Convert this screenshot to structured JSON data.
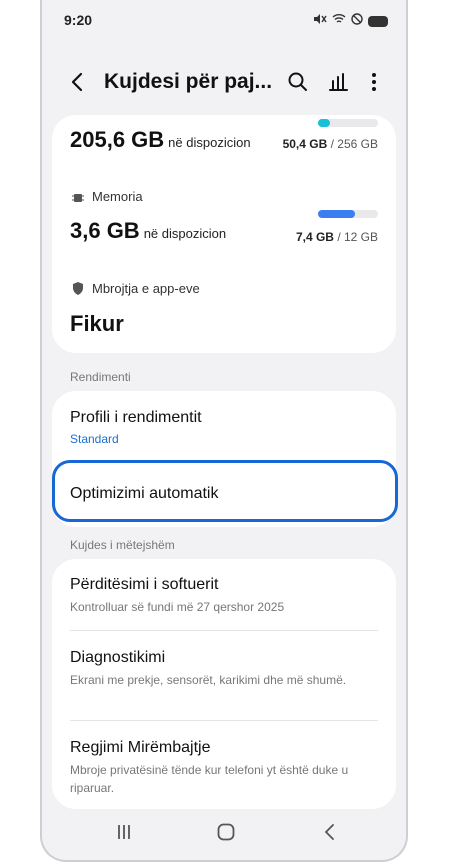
{
  "status": {
    "time": "9:20"
  },
  "appbar": {
    "title": "Kujdesi për paj..."
  },
  "storage": {
    "available_value": "205,6 GB",
    "available_suffix": "në dispozicion",
    "used": "50,4 GB",
    "total": "/ 256 GB",
    "fill_fraction": 0.2
  },
  "memory": {
    "label": "Memoria",
    "available_value": "3,6 GB",
    "available_suffix": "në dispozicion",
    "used": "7,4 GB",
    "total": "/ 12 GB",
    "fill_fraction": 0.62
  },
  "app_protection": {
    "label": "Mbrojtja e app-eve",
    "value": "Fikur"
  },
  "sections": {
    "performance": "Rendimenti",
    "further_care": "Kujdes i mëtejshëm"
  },
  "performance_items": [
    {
      "title": "Profili i rendimentit",
      "sub": "Standard"
    },
    {
      "title": "Optimizimi automatik"
    }
  ],
  "care_items": [
    {
      "title": "Përditësimi i softuerit",
      "sub": "Kontrolluar së fundi më 27 qershor 2025"
    },
    {
      "title": "Diagnostikimi",
      "sub": "Ekrani me prekje, sensorët, karikimi dhe më shumë."
    },
    {
      "title": "Regjimi Mirëmbajtje",
      "sub": "Mbroje privatësinë tënde kur telefoni yt është duke u riparuar."
    }
  ],
  "colors": {
    "accent": "#1767d6",
    "storage_bar": "#16c1d8",
    "memory_bar": "#3b7ef0",
    "link": "#1a6fd6"
  },
  "icons": [
    "back-arrow-icon",
    "search-icon",
    "chart-icon",
    "more-vertical-icon",
    "memory-chip-icon",
    "shield-icon",
    "recents-icon",
    "home-icon",
    "back-nav-icon"
  ]
}
